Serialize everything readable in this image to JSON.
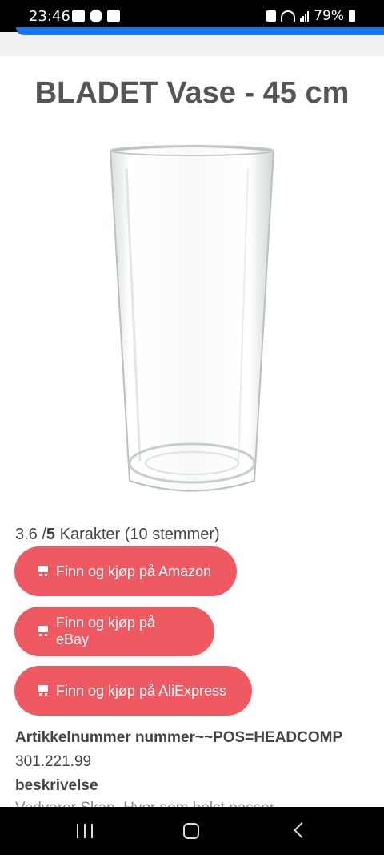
{
  "status_bar": {
    "time": "23:46",
    "battery": "79%",
    "left_icons": [
      "youtube-icon",
      "facebook-icon",
      "check-icon"
    ],
    "right_icons": [
      "lock-icon",
      "wifi-icon",
      "signal-icon",
      "battery-icon"
    ]
  },
  "page": {
    "title": "BLADET Vase - 45 cm",
    "rating": {
      "value": "3.6 /",
      "max": "5",
      "suffix": " Karakter (10 stemmer)"
    },
    "buttons": [
      {
        "label": "Finn og kjøp på Amazon"
      },
      {
        "label": "Finn og kjøp på eBay"
      },
      {
        "label": "Finn og kjøp på AliExpress"
      }
    ],
    "article_label": "Artikkelnummer nummer~~POS=HEADCOMP",
    "article_value": "301.221.99",
    "description_label": "beskrivelse",
    "description_text": "Vedvarer Skap. Hvor som helst passer"
  },
  "colors": {
    "button": "#ef5a62",
    "progress": "#1a73e8"
  },
  "nav": {
    "icons": [
      "recents-icon",
      "home-icon",
      "back-icon"
    ]
  }
}
